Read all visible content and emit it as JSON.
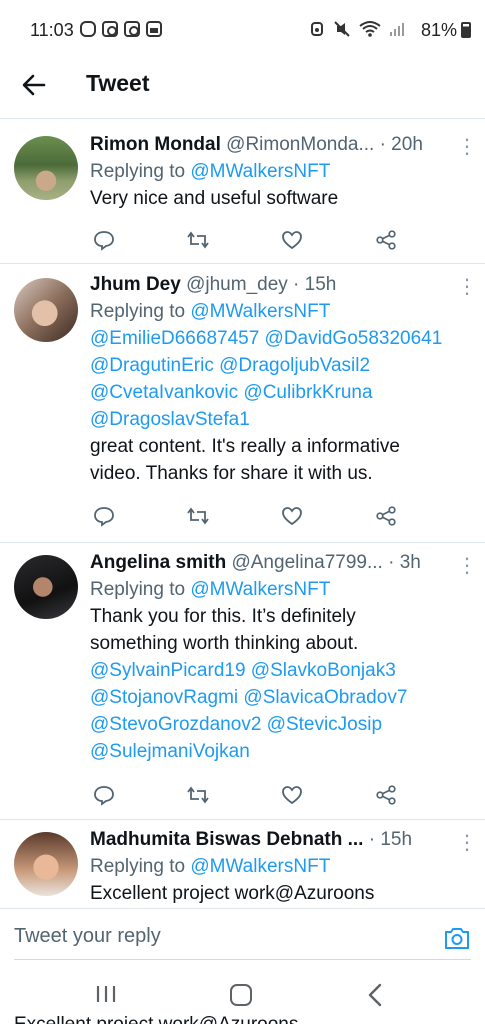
{
  "status_bar": {
    "time": "11:03",
    "battery": "81%"
  },
  "header": {
    "title": "Tweet"
  },
  "tweets": [
    {
      "name": "Rimon Mondal",
      "handle": "@RimonMonda...",
      "time": "· 20h",
      "replying_prefix": "Replying to",
      "replying_to": "@MWalkersNFT",
      "lines": [
        "Very nice and useful software"
      ]
    },
    {
      "name": "Jhum Dey",
      "handle": "@jhum_dey",
      "time": "· 15h",
      "replying_prefix": "Replying to",
      "replying_to": "@MWalkersNFT",
      "mention_lines": [
        "@EmilieD66687457 @DavidGo58320641",
        "@DragutinEric @DragoljubVasil2",
        "@CvetaIvankovic @CulibrkKruna",
        "@DragoslavStefa1"
      ],
      "lines": [
        "great content. It's really a informative",
        "video. Thanks for share it with us."
      ]
    },
    {
      "name": "Angelina smith",
      "handle": "@Angelina7799...",
      "time": "· 3h",
      "replying_prefix": "Replying to",
      "replying_to": "@MWalkersNFT",
      "lines": [
        "Thank you for this. It’s definitely",
        "something worth thinking about."
      ],
      "mention_lines": [
        "@SylvainPicard19 @SlavkoBonjak3",
        "@StojanovRagmi @SlavicaObradov7",
        "@StevoGrozdanov2 @StevicJosip",
        "@SulejmaniVojkan"
      ]
    },
    {
      "name": "Madhumita Biswas Debnath ...",
      "handle": "",
      "time": "· 15h",
      "replying_prefix": "Replying to",
      "replying_to": "@MWalkersNFT",
      "lines": [
        "Excellent project work@Azuroons"
      ]
    }
  ],
  "reply_bar": {
    "placeholder": "Tweet your reply"
  },
  "peek_text": "Excellent project work@Azuroons",
  "colors": {
    "accent": "#1d9bf0",
    "text": "#0f1419",
    "secondary": "#536471",
    "divider": "#e1e8ed"
  },
  "icons": {
    "reply": "comment-icon",
    "retweet": "retweet-icon",
    "like": "heart-icon",
    "share": "share-icon",
    "more": "more-vertical-icon",
    "back": "arrow-left-icon",
    "camera": "camera-icon"
  }
}
